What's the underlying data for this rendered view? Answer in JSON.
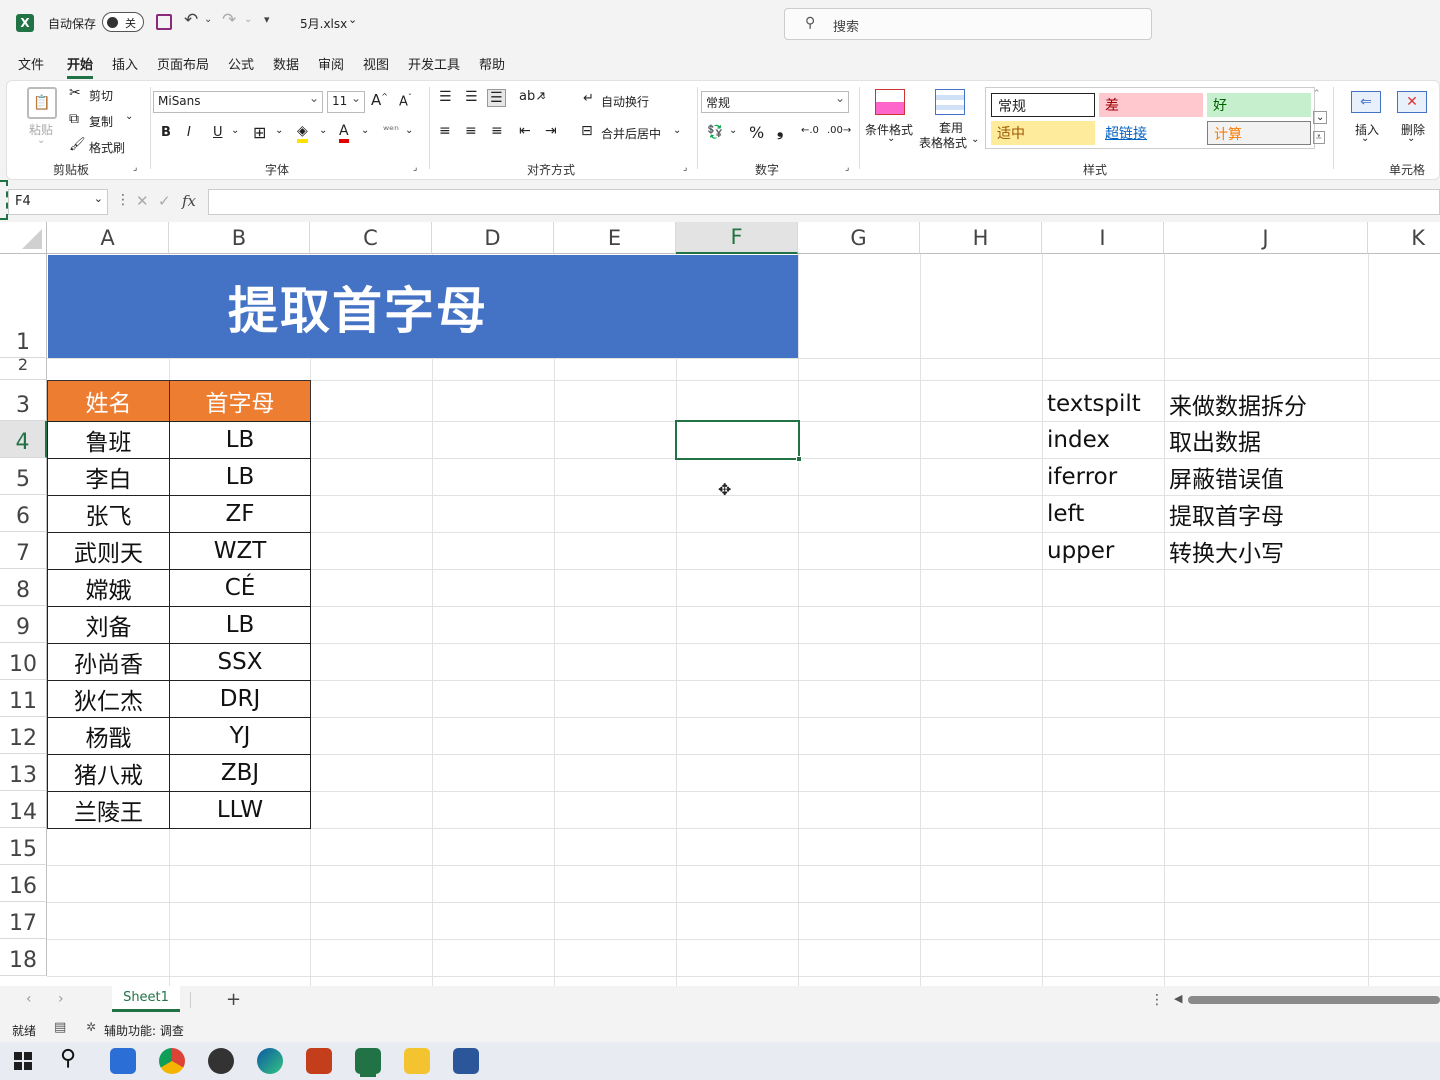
{
  "titlebar": {
    "autosave_label": "自动保存",
    "autosave_state": "关",
    "filename": "5月.xlsx",
    "search_placeholder": "搜索"
  },
  "menu": [
    "文件",
    "开始",
    "插入",
    "页面布局",
    "公式",
    "数据",
    "审阅",
    "视图",
    "开发工具",
    "帮助"
  ],
  "ribbon": {
    "clipboard": {
      "paste": "粘贴",
      "cut": "剪切",
      "copy": "复制",
      "format_painter": "格式刷",
      "label": "剪贴板"
    },
    "font": {
      "name": "MiSans",
      "size": "11",
      "bold": "B",
      "italic": "I",
      "underline": "U",
      "label": "字体"
    },
    "alignment": {
      "wrap": "自动换行",
      "merge": "合并后居中",
      "label": "对齐方式"
    },
    "number": {
      "format": "常规",
      "label": "数字"
    },
    "styles": {
      "conditional": "条件格式",
      "table_format_1": "套用",
      "table_format_2": "表格格式",
      "cells": [
        "常规",
        "差",
        "好",
        "适中",
        "超链接",
        "计算"
      ],
      "label": "样式"
    },
    "cells": {
      "insert": "插入",
      "delete": "删除",
      "label": "单元格"
    }
  },
  "formula_bar": {
    "name_box": "F4",
    "fx": "fx",
    "value": ""
  },
  "columns": [
    "A",
    "B",
    "C",
    "D",
    "E",
    "F",
    "G",
    "H",
    "I",
    "J",
    "K"
  ],
  "rows": [
    "1",
    "2",
    "3",
    "4",
    "5",
    "6",
    "7",
    "8",
    "9",
    "10",
    "11",
    "12",
    "13",
    "14",
    "15",
    "16",
    "17",
    "18"
  ],
  "sheet": {
    "title": "提取首字母",
    "headers": [
      "姓名",
      "首字母"
    ],
    "table": [
      [
        "鲁班",
        "LB"
      ],
      [
        "李白",
        "LB"
      ],
      [
        "张飞",
        "ZF"
      ],
      [
        "武则天",
        "WZT"
      ],
      [
        "嫦娥",
        "CÉ"
      ],
      [
        "刘备",
        "LB"
      ],
      [
        "孙尚香",
        "SSX"
      ],
      [
        "狄仁杰",
        "DRJ"
      ],
      [
        "杨戬",
        "YJ"
      ],
      [
        "猪八戒",
        "ZBJ"
      ],
      [
        "兰陵王",
        "LLW"
      ]
    ],
    "notes": [
      [
        "textspilt",
        "来做数据拆分"
      ],
      [
        "index",
        "取出数据"
      ],
      [
        "iferror",
        "屏蔽错误值"
      ],
      [
        "left",
        "提取首字母"
      ],
      [
        "upper",
        "转换大小写"
      ]
    ]
  },
  "tabs": {
    "sheet1": "Sheet1",
    "add": "+"
  },
  "status": {
    "ready": "就绪",
    "accessibility": "辅助功能: 调查"
  },
  "colors": {
    "excel_green": "#217346",
    "title_fill": "#4472c4",
    "header_fill": "#ed7d31"
  }
}
